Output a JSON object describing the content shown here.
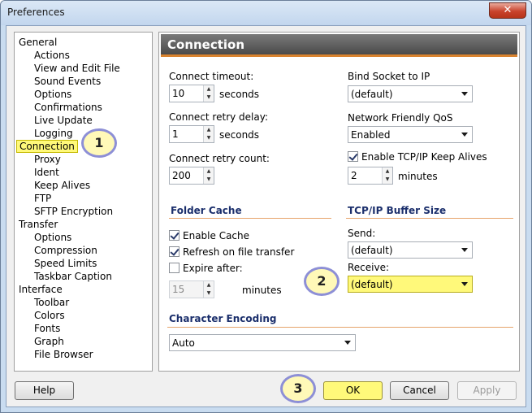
{
  "window": {
    "title": "Preferences",
    "close_glyph": "✕"
  },
  "tree": {
    "items": [
      {
        "label": "General",
        "level": 0
      },
      {
        "label": "Actions",
        "level": 1
      },
      {
        "label": "View and Edit File",
        "level": 1
      },
      {
        "label": "Sound Events",
        "level": 1
      },
      {
        "label": "Options",
        "level": 1
      },
      {
        "label": "Confirmations",
        "level": 1
      },
      {
        "label": "Live Update",
        "level": 1
      },
      {
        "label": "Logging",
        "level": 1
      },
      {
        "label": "Connection",
        "level": 0,
        "selected": true
      },
      {
        "label": "Proxy",
        "level": 1
      },
      {
        "label": "Ident",
        "level": 1
      },
      {
        "label": "Keep Alives",
        "level": 1
      },
      {
        "label": "FTP",
        "level": 1
      },
      {
        "label": "SFTP Encryption",
        "level": 1
      },
      {
        "label": "Transfer",
        "level": 0
      },
      {
        "label": "Options",
        "level": 1
      },
      {
        "label": "Compression",
        "level": 1
      },
      {
        "label": "Speed Limits",
        "level": 1
      },
      {
        "label": "Taskbar Caption",
        "level": 1
      },
      {
        "label": "Interface",
        "level": 0
      },
      {
        "label": "Toolbar",
        "level": 1
      },
      {
        "label": "Colors",
        "level": 1
      },
      {
        "label": "Fonts",
        "level": 1
      },
      {
        "label": "Graph",
        "level": 1
      },
      {
        "label": "File Browser",
        "level": 1
      }
    ]
  },
  "panel": {
    "title": "Connection",
    "connect_timeout": {
      "label": "Connect timeout:",
      "value": "10",
      "unit": "seconds"
    },
    "connect_retry_delay": {
      "label": "Connect retry delay:",
      "value": "1",
      "unit": "seconds"
    },
    "connect_retry_count": {
      "label": "Connect retry count:",
      "value": "200"
    },
    "bind_socket": {
      "label": "Bind Socket to IP",
      "value": "(default)"
    },
    "network_qos": {
      "label": "Network Friendly QoS",
      "value": "Enabled"
    },
    "keep_alives": {
      "label": "Enable TCP/IP Keep Alives",
      "checked": true,
      "value": "2",
      "unit": "minutes"
    },
    "folder_cache": {
      "heading": "Folder Cache",
      "enable_cache": {
        "label": "Enable Cache",
        "checked": true
      },
      "refresh": {
        "label": "Refresh on file transfer",
        "checked": true
      },
      "expire": {
        "label": "Expire after:",
        "checked": false,
        "value": "15",
        "unit": "minutes"
      }
    },
    "buffer": {
      "heading": "TCP/IP Buffer Size",
      "send_label": "Send:",
      "send_value": "(default)",
      "receive_label": "Receive:",
      "receive_value": "(default)"
    },
    "encoding": {
      "heading": "Character Encoding",
      "value": "Auto"
    }
  },
  "buttons": {
    "help": "Help",
    "ok": "OK",
    "cancel": "Cancel",
    "apply": "Apply"
  },
  "markers": {
    "m1": "1",
    "m2": "2",
    "m3": "3"
  },
  "colors": {
    "highlight": "#fff97a",
    "header_accent": "#d9832f",
    "section_text": "#1b2f6c"
  }
}
